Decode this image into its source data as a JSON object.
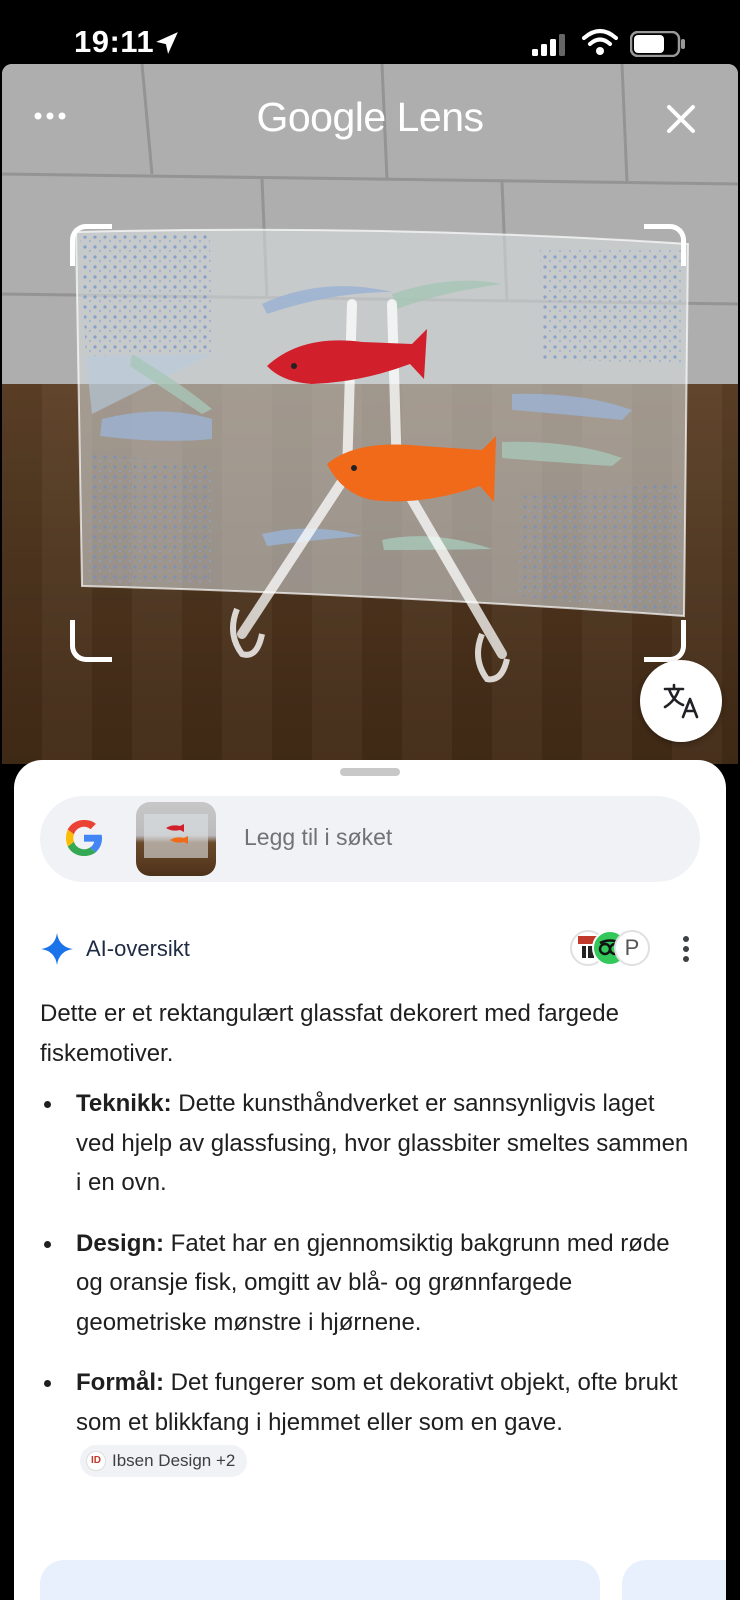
{
  "status_bar": {
    "time": "19:11"
  },
  "header": {
    "title": "Google Lens"
  },
  "search": {
    "placeholder": "Legg til i søket"
  },
  "ai_overview": {
    "label": "AI-oversikt",
    "source_c_letter": "P",
    "intro": "Dette er et rektangulært glassfat dekorert med fargede fiskemotiver.",
    "bullets": [
      {
        "title": "Teknikk:",
        "text": " Dette kunsthåndverket er sannsynligvis laget ved hjelp av glassfusing, hvor glassbiter smeltes sammen i en ovn."
      },
      {
        "title": "Design:",
        "text": " Fatet har en gjennomsiktig bakgrunn med røde og oransje fisk, omgitt av blå- og grønnfargede geometriske mønstre i hjørnene."
      },
      {
        "title": "Formål:",
        "text": " Det fungerer som et dekorativt objekt, ofte brukt som et blikkfang i hjemmet eller som en gave."
      }
    ],
    "source_chip": "Ibsen Design +2"
  },
  "colors": {
    "accent": "#1a73e8",
    "red_fish": "#d11f2b",
    "orange_fish": "#f06a1a"
  }
}
